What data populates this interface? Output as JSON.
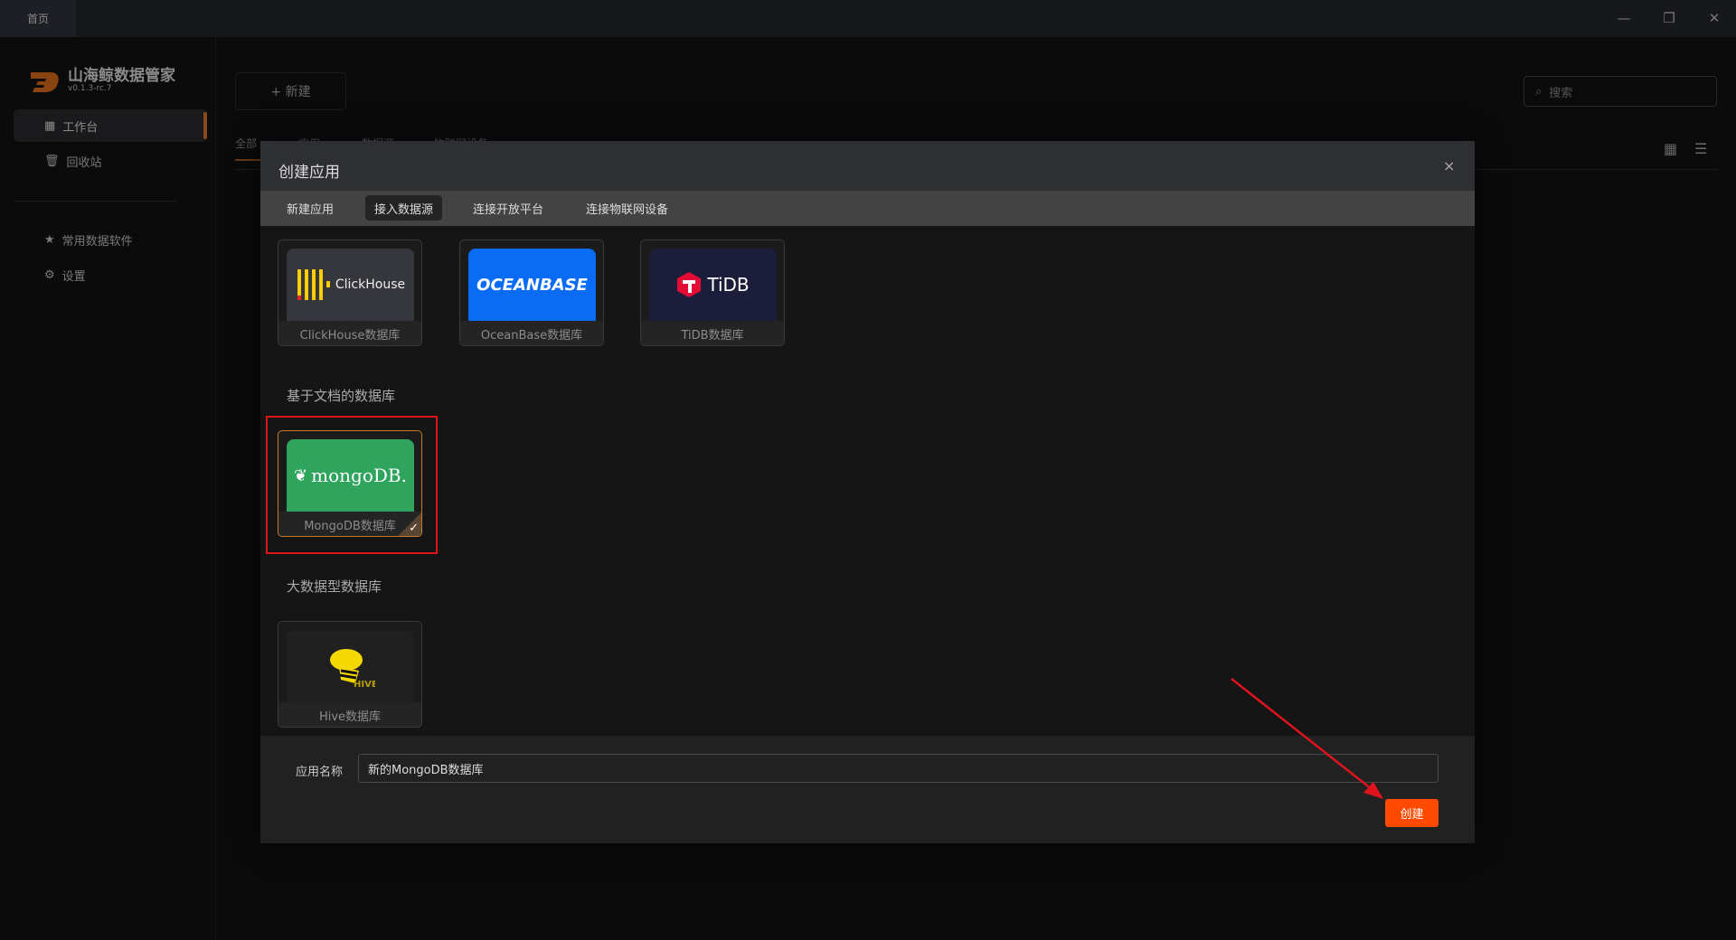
{
  "titlebar": {
    "home_tab": "首页",
    "minimize": "—",
    "restore": "❐",
    "close": "✕"
  },
  "sidebar": {
    "app_title": "山海鲸数据管家",
    "version": "v0.1.3-rc.7",
    "items": [
      {
        "label": "工作台",
        "icon": "grid-icon"
      },
      {
        "label": "回收站",
        "icon": "trash-icon"
      },
      {
        "label": "常用数据软件",
        "icon": "star-icon"
      },
      {
        "label": "设置",
        "icon": "gear-icon"
      }
    ]
  },
  "toolbar": {
    "new_label": "+ 新建",
    "search_placeholder": "搜索"
  },
  "bg_tabs": [
    {
      "label": "全部"
    },
    {
      "label": "应用"
    },
    {
      "label": "数据源"
    },
    {
      "label": "物联网设备"
    }
  ],
  "modal": {
    "title": "创建应用",
    "close": "×",
    "tabs": [
      {
        "label": "新建应用"
      },
      {
        "label": "接入数据源",
        "active": true
      },
      {
        "label": "连接开放平台"
      },
      {
        "label": "连接物联网设备"
      }
    ],
    "row1": [
      {
        "label": "ClickHouse数据库",
        "logo": "ClickHouse"
      },
      {
        "label": "OceanBase数据库",
        "logo": "OCEANBASE"
      },
      {
        "label": "TiDB数据库",
        "logo": "TiDB"
      }
    ],
    "section_doc": "基于文档的数据库",
    "mongo": {
      "label": "MongoDB数据库",
      "logo": "mongoDB.",
      "selected": true
    },
    "section_bigdata": "大数据型数据库",
    "hive": {
      "label": "Hive数据库",
      "logo": "HIVE"
    },
    "name_label": "应用名称",
    "name_value": "新的MongoDB数据库",
    "create_label": "创建"
  },
  "colors": {
    "accent": "#ff4a00",
    "selected_border": "#c87a2a",
    "annotation": "#e0141c"
  }
}
